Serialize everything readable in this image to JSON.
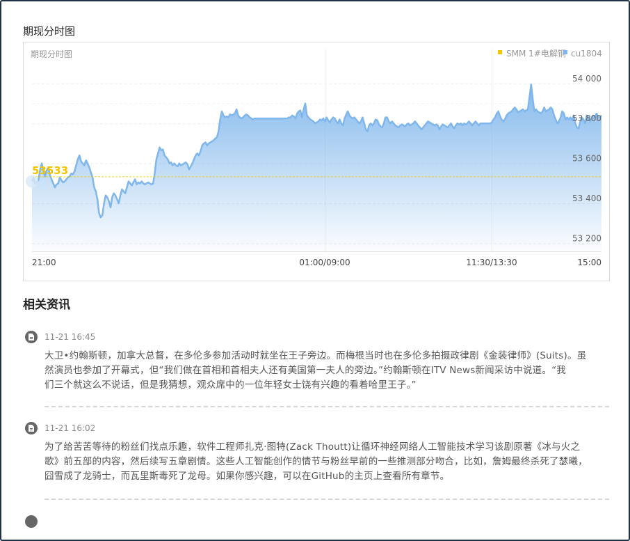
{
  "page": {
    "section_title": "期现分时图"
  },
  "chart_data": {
    "type": "area",
    "title": "期现分时图",
    "legend": [
      {
        "name": "SMM 1#电解铜",
        "color": "#f2c500"
      },
      {
        "name": "cu1804",
        "color": "#7fb6ec"
      }
    ],
    "legend_position": "top-right",
    "x_ticks": [
      "21:00",
      "01:00/09:00",
      "11:30/13:30",
      "15:00"
    ],
    "y_ticks": [
      "53 200",
      "53 400",
      "53 600",
      "53 800",
      "54 000"
    ],
    "y_tick_values": [
      53200,
      53400,
      53600,
      53800,
      54000
    ],
    "ylim": [
      53160,
      54170
    ],
    "grid": true,
    "spot_price": {
      "value": 53533,
      "label": "53533",
      "color": "#f2c500"
    },
    "series": [
      {
        "name": "cu1804",
        "color": "#7fb6ec",
        "values": [
          53510,
          53530,
          53500,
          53505,
          53520,
          53570,
          53600,
          53560,
          53535,
          53565,
          53580,
          53540,
          53520,
          53500,
          53480,
          53495,
          53500,
          53530,
          53515,
          53505,
          53510,
          53520,
          53530,
          53535,
          53550,
          53545,
          53560,
          53590,
          53620,
          53640,
          53610,
          53600,
          53590,
          53615,
          53600,
          53580,
          53555,
          53530,
          53480,
          53460,
          53420,
          53350,
          53330,
          53340,
          53400,
          53440,
          53430,
          53410,
          53380,
          53430,
          53450,
          53440,
          53420,
          53400,
          53440,
          53470,
          53460,
          53450,
          53480,
          53510,
          53500,
          53490,
          53505,
          53520,
          53495,
          53505,
          53500,
          53510,
          53500,
          53495,
          53500,
          53505,
          53500,
          53495,
          53500,
          53550,
          53620,
          53650,
          53680,
          53665,
          53670,
          53640,
          53630,
          53620,
          53600,
          53605,
          53590,
          53600,
          53590,
          53585,
          53600,
          53590,
          53595,
          53600,
          53605,
          53595,
          53570,
          53585,
          53600,
          53620,
          53640,
          53650,
          53640,
          53660,
          53690,
          53700,
          53705,
          53690,
          53700,
          53705,
          53710,
          53715,
          53725,
          53730,
          53760,
          53820,
          53860,
          53840,
          53830,
          53835,
          53830,
          53845,
          53840,
          53845,
          53850,
          53870,
          53840,
          53830,
          53825,
          53830,
          53840,
          53845,
          53840,
          53830,
          53825,
          53820,
          53825,
          53825,
          53825,
          53825,
          53825,
          53825,
          53825,
          53825,
          53825,
          53825,
          53825,
          53825,
          53825,
          53825,
          53825,
          53825,
          53825,
          53825,
          53825,
          53825,
          53825,
          53830,
          53830,
          53840,
          53835,
          53825,
          53850,
          53860,
          53865,
          53830,
          53870,
          53900,
          53840,
          53830,
          53820,
          53815,
          53810,
          53800,
          53805,
          53810,
          53820,
          53815,
          53825,
          53810,
          53830,
          53815,
          53805,
          53820,
          53830,
          53825,
          53810,
          53800,
          53820,
          53800,
          53790,
          53825,
          53845,
          53860,
          53840,
          53830,
          53825,
          53830,
          53820,
          53810,
          53800,
          53810,
          53830,
          53800,
          53770,
          53760,
          53790,
          53800,
          53790,
          53800,
          53820,
          53815,
          53795,
          53785,
          53780,
          53800,
          53830,
          53830,
          53810,
          53800,
          53810,
          53800,
          53790,
          53785,
          53780,
          53790,
          53795,
          53790,
          53785,
          53795,
          53800,
          53790,
          53795,
          53800,
          53810,
          53800,
          53790,
          53780,
          53770,
          53780,
          53790,
          53800,
          53810,
          53805,
          53800,
          53795,
          53790,
          53795,
          53790,
          53770,
          53785,
          53795,
          53790,
          53785,
          53780,
          53790,
          53800,
          53785,
          53775,
          53790,
          53800,
          53795,
          53800,
          53790,
          53800,
          53795,
          53800,
          53810,
          53800,
          53790,
          53800,
          53810,
          53800,
          53790,
          53800,
          53800,
          53800,
          53800,
          53800,
          53800,
          53800,
          53805,
          53820,
          53830,
          53850,
          53860,
          53835,
          53820,
          53810,
          53820,
          53840,
          53850,
          53855,
          53860,
          53870,
          53880,
          53870,
          53855,
          53860,
          53865,
          53870,
          53860,
          53865,
          53870,
          53930,
          53995,
          53920,
          53860,
          53870,
          53860,
          53855,
          53850,
          53860,
          53880,
          53860,
          53865,
          53870,
          53880,
          53870,
          53840,
          53820,
          53800,
          53810,
          53830,
          53860,
          53850,
          53820,
          53830,
          53820,
          53830,
          53815,
          53840,
          53800,
          53780,
          53775,
          53810,
          53830,
          53820,
          53800,
          53840,
          53830,
          53810,
          53830,
          53840,
          53830,
          53850,
          53830,
          53830,
          53840
        ]
      }
    ]
  },
  "news": {
    "title": "相关资讯",
    "items": [
      {
        "time": "11-21 16:45",
        "lines": [
          "大卫•约翰斯顿，加拿大总督，在多伦多参加活动时就坐在王子旁边。而梅根当时也在多伦多拍摄政律剧《金装律师》(Suits)。虽",
          "然演员也参加了开幕式，但“我们做在首相和首相夫人还有美国第一夫人的旁边。”约翰斯顿在ITV News新闻采访中说道。“我",
          "们三个就这么不说话，但是我猜想，观众席中的一位年轻女士饶有兴趣的看着哈里王子。”"
        ]
      },
      {
        "time": "11-21 16:02",
        "lines": [
          "为了给苦苦等待的粉丝们找点乐趣，软件工程师扎克·图特(Zack Thoutt)让循环神经网络人工智能技术学习该剧原著《冰与火之",
          "歌》前五部的内容，然后续写五章剧情。这些人工智能创作的情节与粉丝早前的一些推测部分吻合，比如，詹姆最终杀死了瑟曦，",
          "囧雪成了龙骑士，而瓦里斯毒死了龙母。如果你感兴趣，可以在GitHub的主页上查看所有章节。"
        ]
      }
    ]
  }
}
